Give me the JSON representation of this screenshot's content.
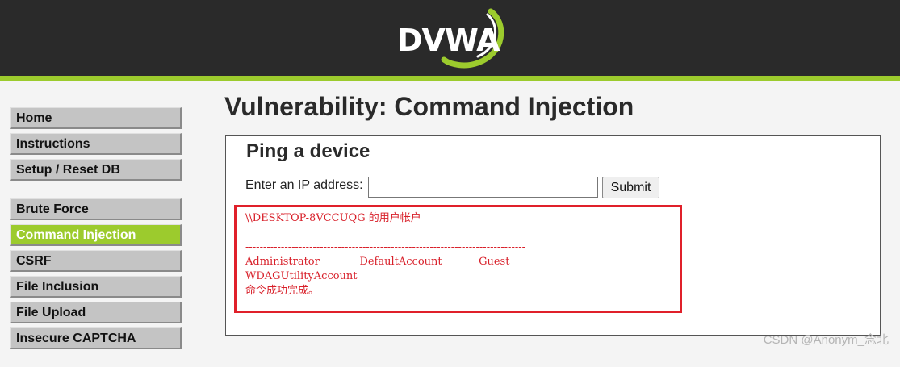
{
  "header": {
    "logo_text": "DVWA",
    "colors": {
      "bar": "#2a2a2a",
      "accent": "#9ccb2d"
    }
  },
  "sidebar": {
    "group1": [
      {
        "label": "Home",
        "active": false
      },
      {
        "label": "Instructions",
        "active": false
      },
      {
        "label": "Setup / Reset DB",
        "active": false
      }
    ],
    "group2": [
      {
        "label": "Brute Force",
        "active": false
      },
      {
        "label": "Command Injection",
        "active": true
      },
      {
        "label": "CSRF",
        "active": false
      },
      {
        "label": "File Inclusion",
        "active": false
      },
      {
        "label": "File Upload",
        "active": false
      },
      {
        "label": "Insecure CAPTCHA",
        "active": false
      }
    ]
  },
  "main": {
    "title": "Vulnerability: Command Injection",
    "section_title": "Ping a device",
    "ip_label": "Enter an IP address:",
    "ip_value": "",
    "submit_label": "Submit",
    "output": "\\\\DESKTOP-8VCCUQG 的用户帐户\n\n-------------------------------------------------------------------------------\nAdministrator            DefaultAccount           Guest\nWDAGUtilityAccount\n命令成功完成。",
    "output_color": "#d8202a",
    "highlight_color": "#e0202a"
  },
  "watermark": "CSDN @Anonym_念北"
}
